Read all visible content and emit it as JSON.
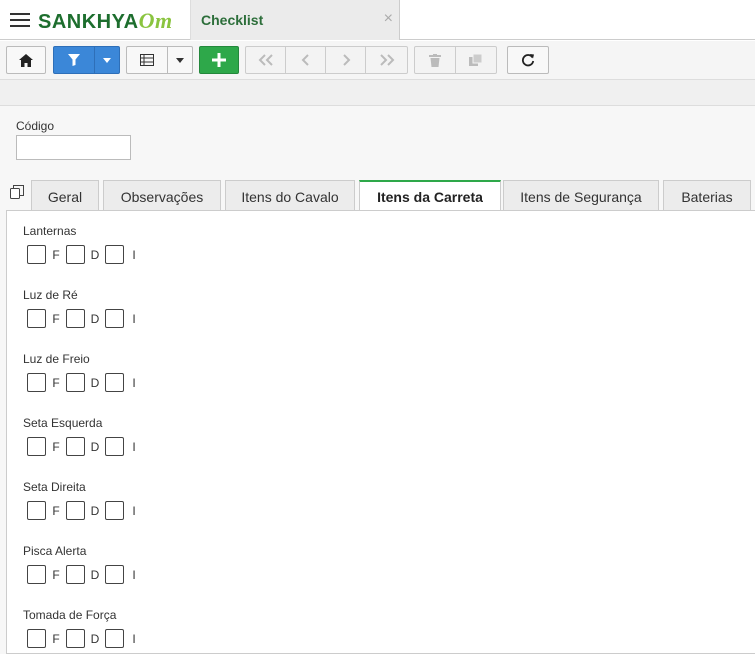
{
  "app": {
    "logo_text": "SANKHYA",
    "logo_suffix": "Om"
  },
  "window_tab": {
    "title": "Checklist",
    "close": "×"
  },
  "toolbar": {
    "buttons": [
      {
        "name": "home",
        "icon": "home-icon"
      },
      {
        "name": "filter",
        "icon": "filter-icon"
      },
      {
        "name": "grid",
        "icon": "grid-icon"
      },
      {
        "name": "add",
        "icon": "plus-icon"
      },
      {
        "name": "first",
        "icon": "double-chevron-left-icon"
      },
      {
        "name": "prev",
        "icon": "chevron-left-icon"
      },
      {
        "name": "next",
        "icon": "chevron-right-icon"
      },
      {
        "name": "last",
        "icon": "double-chevron-right-icon"
      },
      {
        "name": "delete",
        "icon": "trash-icon"
      },
      {
        "name": "duplicate",
        "icon": "copy-icon"
      },
      {
        "name": "refresh",
        "icon": "refresh-icon"
      }
    ]
  },
  "form": {
    "codigo_label": "Código",
    "codigo_value": ""
  },
  "tabs": [
    {
      "label": "Geral"
    },
    {
      "label": "Observações"
    },
    {
      "label": "Itens do Cavalo"
    },
    {
      "label": "Itens da Carreta",
      "active": true
    },
    {
      "label": "Itens de Segurança"
    },
    {
      "label": "Baterias"
    }
  ],
  "checklist": {
    "options": [
      "F",
      "D",
      "I"
    ],
    "items": [
      {
        "label": "Lanternas"
      },
      {
        "label": "Luz de Ré"
      },
      {
        "label": "Luz de Freio"
      },
      {
        "label": "Seta Esquerda"
      },
      {
        "label": "Seta Direita"
      },
      {
        "label": "Pisca Alerta"
      },
      {
        "label": "Tomada de Força"
      }
    ]
  },
  "colors": {
    "brand_green": "#1d6e2e",
    "accent_lime": "#8ac43f",
    "filter_blue": "#3b87d8",
    "add_green": "#2ea84a"
  }
}
